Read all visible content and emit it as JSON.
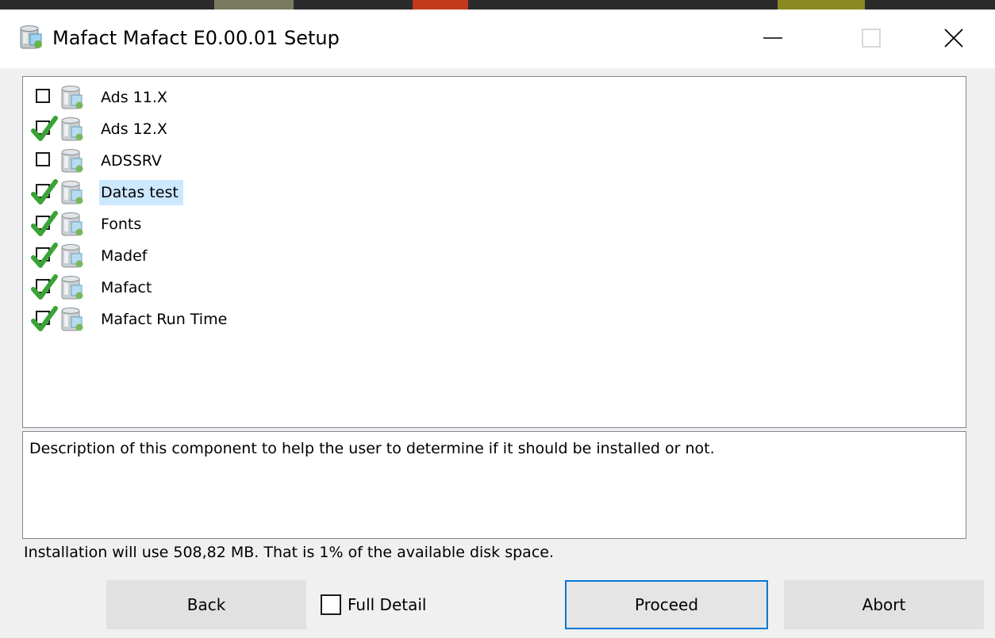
{
  "window": {
    "title": "Mafact Mafact E0.00.01 Setup",
    "controls": [
      "minimize",
      "maximize",
      "close"
    ]
  },
  "components": [
    {
      "label": "Ads 11.X",
      "checked": false,
      "selected": false
    },
    {
      "label": "Ads 12.X",
      "checked": true,
      "selected": false
    },
    {
      "label": "ADSSRV",
      "checked": false,
      "selected": false
    },
    {
      "label": "Datas test",
      "checked": true,
      "selected": true
    },
    {
      "label": "Fonts",
      "checked": true,
      "selected": false
    },
    {
      "label": "Madef",
      "checked": true,
      "selected": false
    },
    {
      "label": "Mafact",
      "checked": true,
      "selected": false
    },
    {
      "label": "Mafact Run Time",
      "checked": true,
      "selected": false
    }
  ],
  "description": "Description of this component to help the user to determine if it should be installed or not.",
  "status": "Installation will use 508,82 MB.  That is 1% of the available disk space.",
  "buttons": {
    "back": "Back",
    "full_detail": "Full Detail",
    "full_detail_checked": false,
    "proceed": "Proceed",
    "abort": "Abort"
  },
  "icons": {
    "app": "installer-package-icon",
    "component": "package-icon",
    "check": "green-checkmark-icon"
  },
  "colors": {
    "check_green": "#3aa335",
    "selection": "#cce8ff",
    "focus_border": "#0078d7"
  }
}
